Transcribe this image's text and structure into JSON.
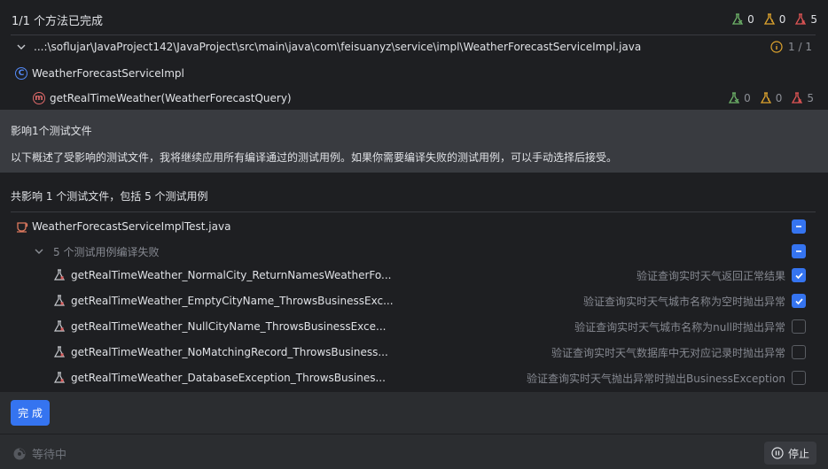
{
  "header": {
    "title": "1/1 个方法已完成",
    "stats": {
      "passed": "0",
      "skipped": "0",
      "failed": "5"
    }
  },
  "path": {
    "text": "...:\\soflujar\\JavaProject142\\JavaProject\\src\\main\\java\\com\\feisuanyz\\service\\impl\\WeatherForecastServiceImpl.java",
    "progress": "1 / 1"
  },
  "class_row": {
    "label": "WeatherForecastServiceImpl",
    "icon_letter": "C"
  },
  "method_row": {
    "label": "getRealTimeWeather(WeatherForecastQuery)",
    "icon_letter": "m",
    "stats": {
      "passed": "0",
      "skipped": "0",
      "failed": "5"
    }
  },
  "info": {
    "title": "影响1个测试文件",
    "description": "以下概述了受影响的测试文件，我将继续应用所有编译通过的测试用例。如果你需要编译失败的测试用例，可以手动选择后接受。"
  },
  "summary": "共影响 1 个测试文件，包括 5 个测试用例",
  "file": {
    "label": "WeatherForecastServiceImplTest.java"
  },
  "group": {
    "label": "5 个测试用例编译失败"
  },
  "cases": [
    {
      "name": "getRealTimeWeather_NormalCity_ReturnNamesWeatherFo...",
      "desc": "验证查询实时天气返回正常结果",
      "checked": true
    },
    {
      "name": "getRealTimeWeather_EmptyCityName_ThrowsBusinessExc...",
      "desc": "验证查询实时天气城市名称为空时抛出异常",
      "checked": true
    },
    {
      "name": "getRealTimeWeather_NullCityName_ThrowsBusinessExce...",
      "desc": "验证查询实时天气城市名称为null时抛出异常",
      "checked": false
    },
    {
      "name": "getRealTimeWeather_NoMatchingRecord_ThrowsBusiness...",
      "desc": "验证查询实时天气数据库中无对应记录时抛出异常",
      "checked": false
    },
    {
      "name": "getRealTimeWeather_DatabaseException_ThrowsBusines...",
      "desc": "验证查询实时天气抛出异常时抛出BusinessException",
      "checked": false
    }
  ],
  "buttons": {
    "done": "完 成",
    "stop": "停止"
  },
  "status": {
    "waiting": "等待中"
  },
  "colors": {
    "accent": "#3574f0",
    "passed": "#6fb56a",
    "skipped": "#e0a52e",
    "failed": "#e05555"
  }
}
